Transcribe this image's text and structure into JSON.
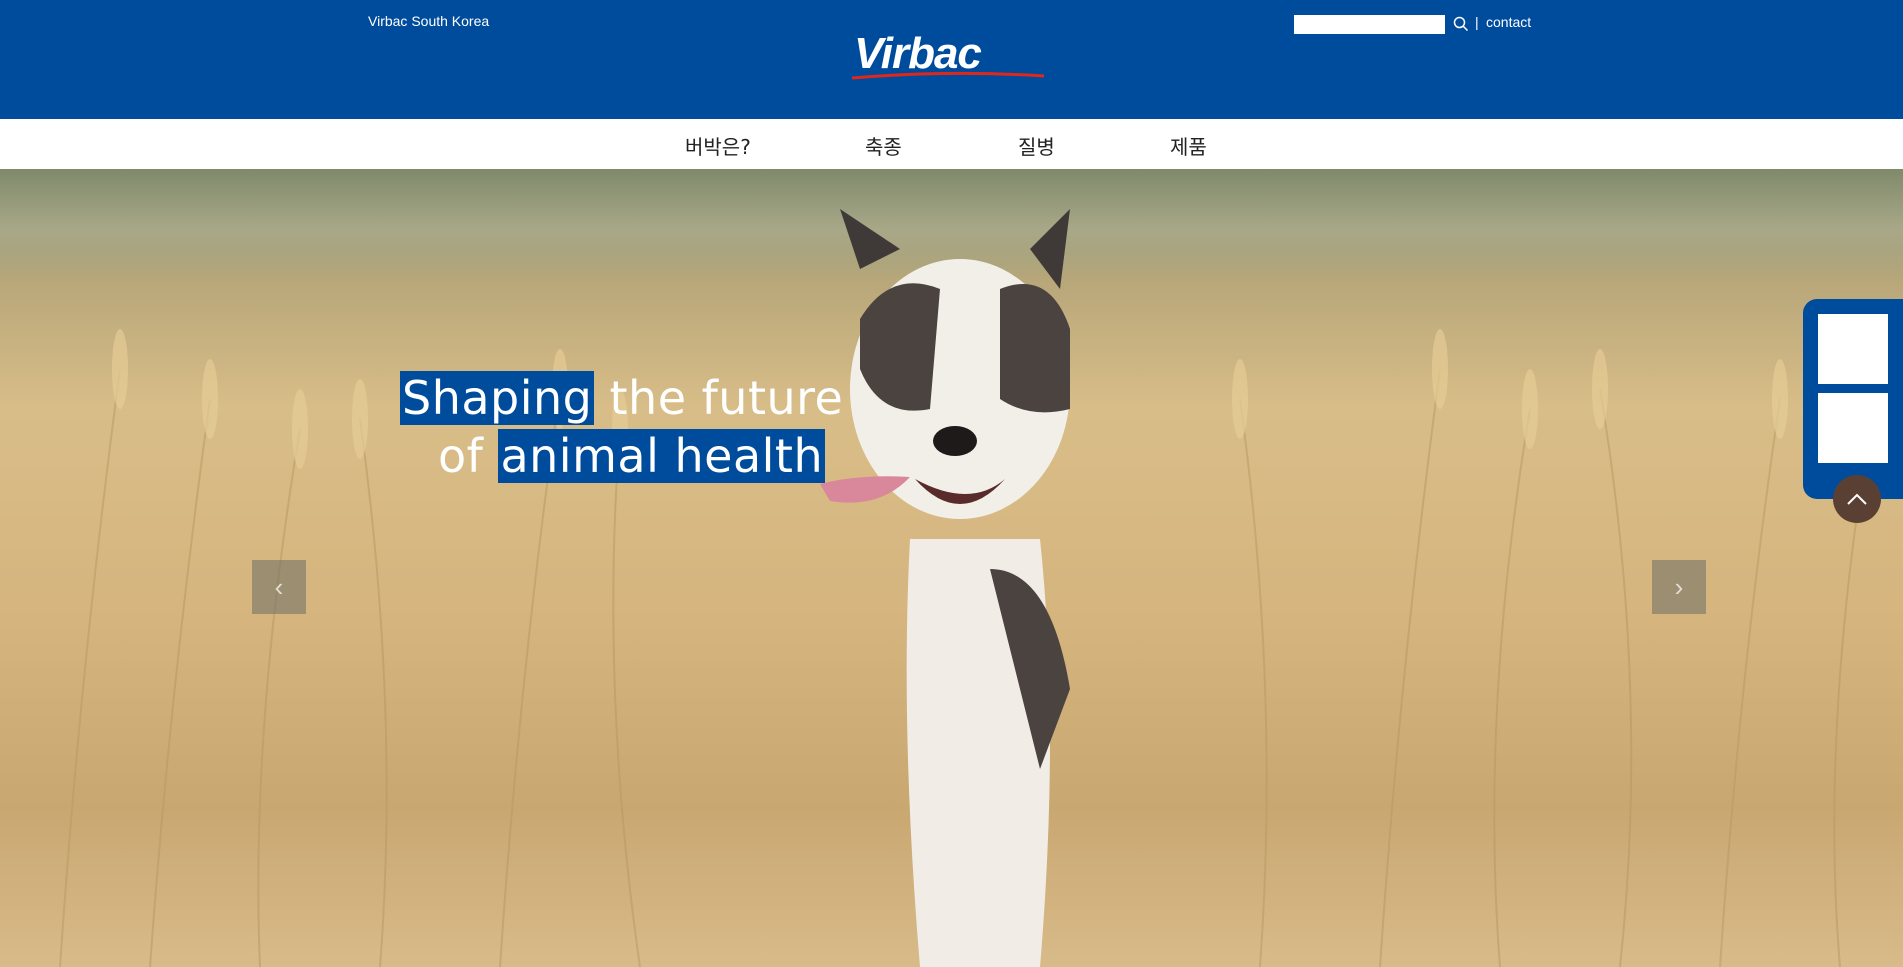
{
  "header": {
    "country": "Virbac South Korea",
    "logo_text": "Virbac",
    "search": {
      "value": "",
      "placeholder": ""
    },
    "separator": "|",
    "contact_label": "contact"
  },
  "nav": {
    "items": [
      {
        "label": "버박은?"
      },
      {
        "label": "축종"
      },
      {
        "label": "질병"
      },
      {
        "label": "제품"
      }
    ]
  },
  "hero": {
    "tagline": {
      "line1_highlight": "Shaping",
      "line1_rest": " the future",
      "line2_plain": "of ",
      "line2_highlight": "animal health"
    },
    "prev_arrow": "‹",
    "next_arrow": "›"
  },
  "colors": {
    "brand_blue": "#004c9c",
    "logo_red": "#e1261c",
    "scroll_top_bg": "#5a3f33"
  },
  "icons": [
    "search-icon",
    "chevron-left-icon",
    "chevron-right-icon",
    "chevron-up-icon"
  ]
}
